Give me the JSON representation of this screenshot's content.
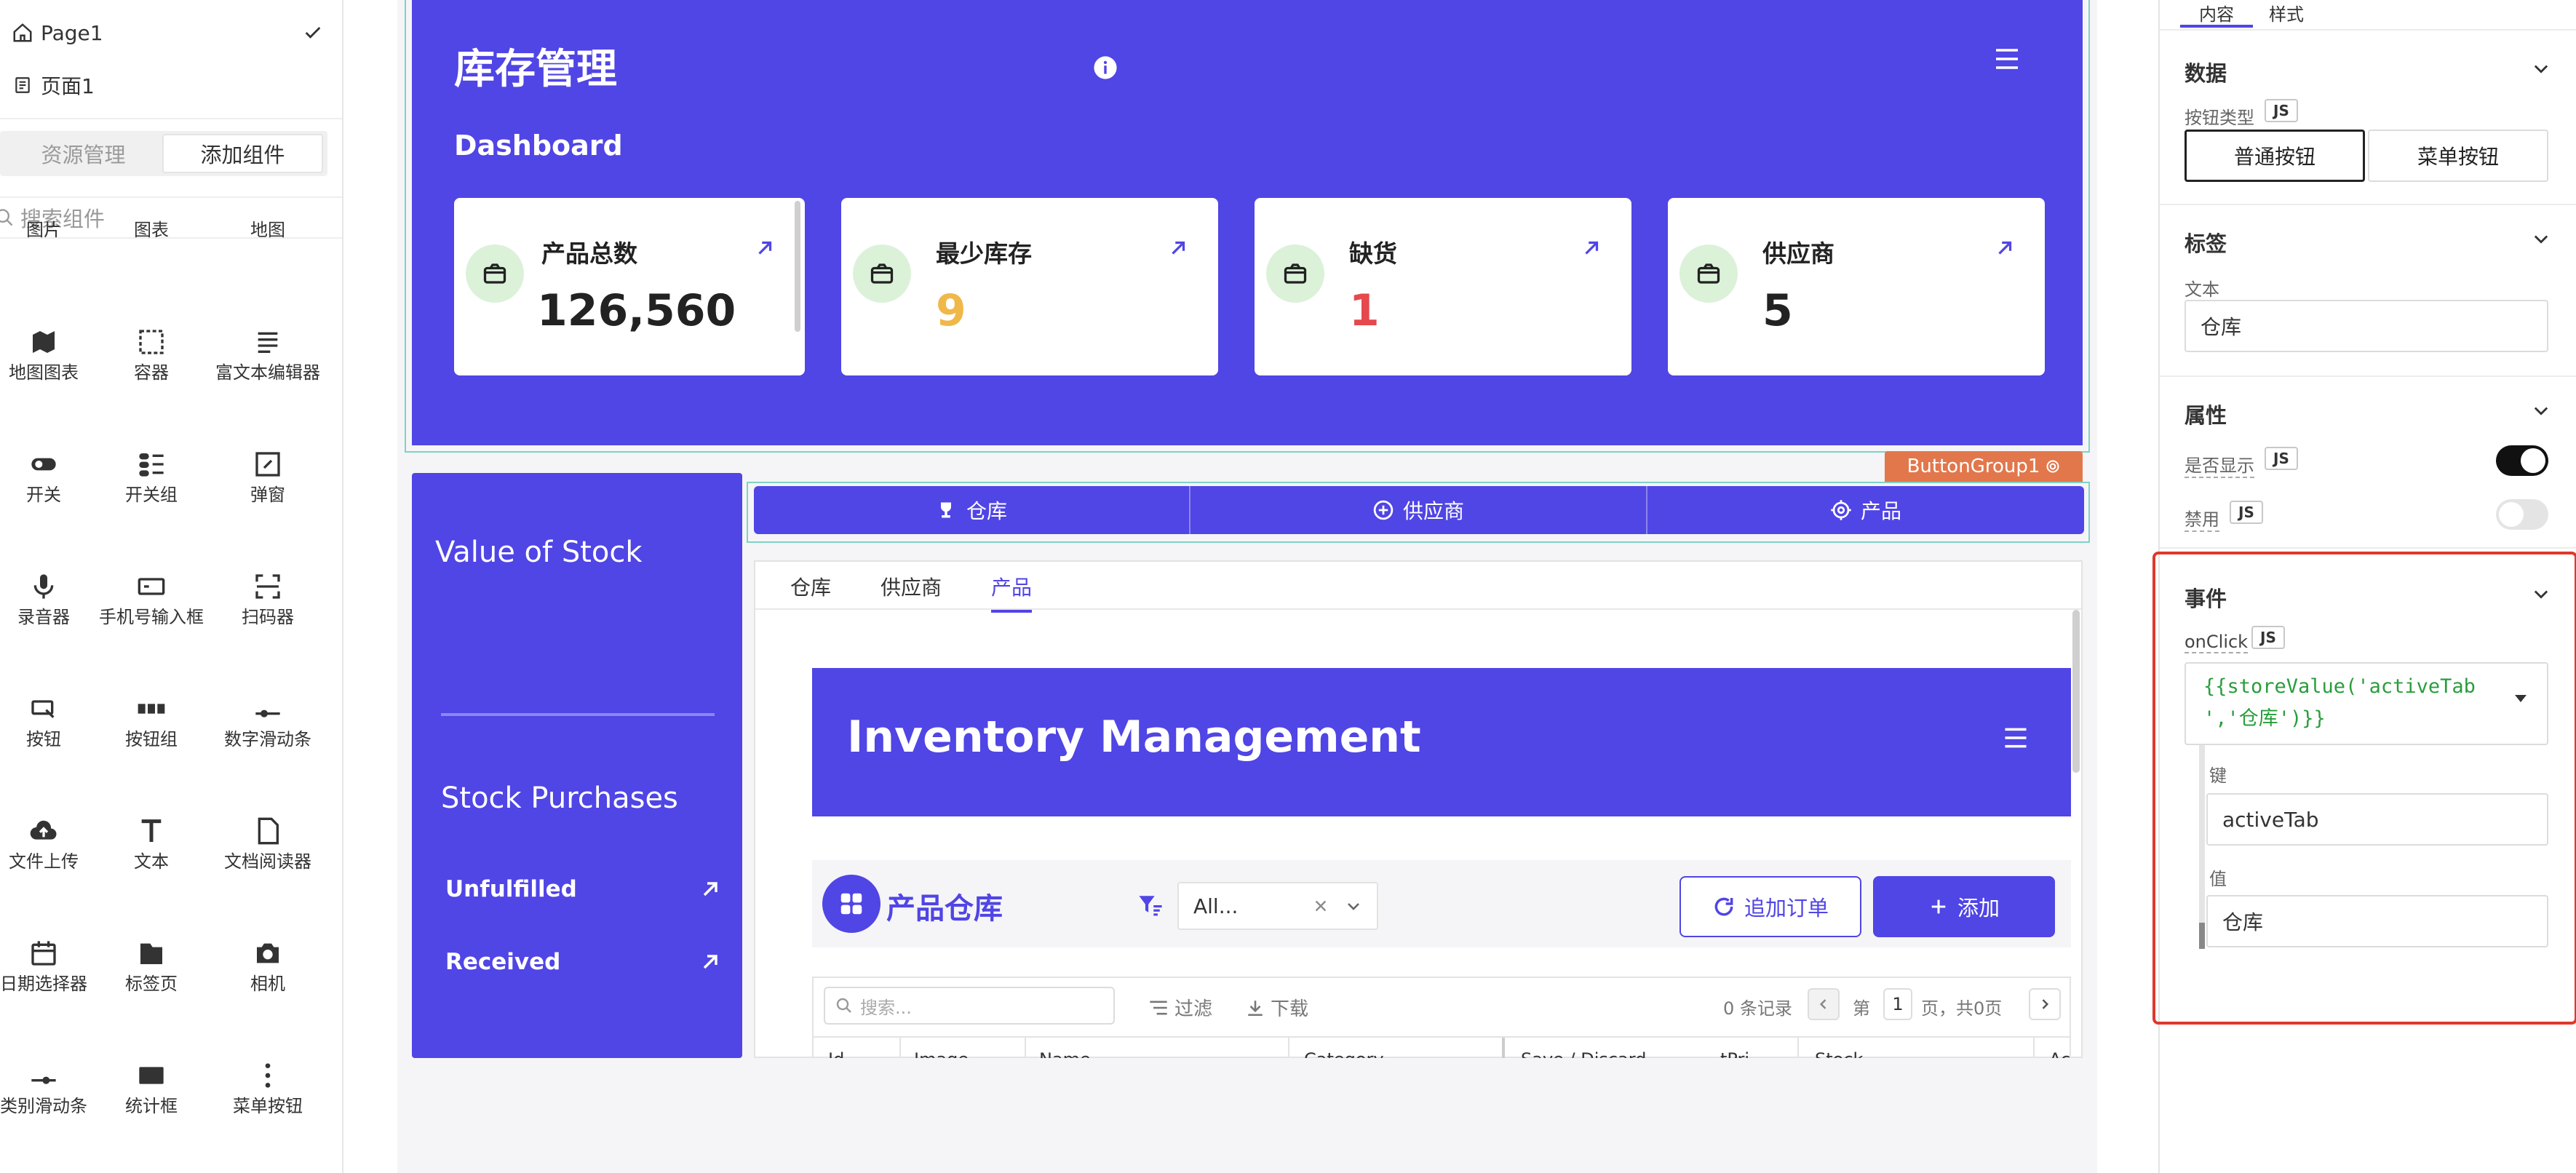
{
  "left": {
    "page_group": "Page1",
    "page_item": "页面1",
    "tabs": [
      "资源管理",
      "添加组件"
    ],
    "search_placeholder": "搜索组件",
    "widgets": [
      {
        "label": "图片",
        "icon": "image-icon"
      },
      {
        "label": "图表",
        "icon": "chart-icon"
      },
      {
        "label": "地图",
        "icon": "map-icon"
      },
      {
        "label": "地图图表",
        "icon": "map-chart-icon"
      },
      {
        "label": "容器",
        "icon": "container-icon"
      },
      {
        "label": "富文本编辑器",
        "icon": "rich-text-icon"
      },
      {
        "label": "开关",
        "icon": "toggle-icon"
      },
      {
        "label": "开关组",
        "icon": "toggle-group-icon"
      },
      {
        "label": "弹窗",
        "icon": "modal-icon"
      },
      {
        "label": "录音器",
        "icon": "microphone-icon"
      },
      {
        "label": "手机号输入框",
        "icon": "phone-input-icon"
      },
      {
        "label": "扫码器",
        "icon": "scanner-icon"
      },
      {
        "label": "按钮",
        "icon": "button-icon"
      },
      {
        "label": "按钮组",
        "icon": "button-group-icon"
      },
      {
        "label": "数字滑动条",
        "icon": "number-slider-icon"
      },
      {
        "label": "文件上传",
        "icon": "upload-icon"
      },
      {
        "label": "文本",
        "icon": "text-icon"
      },
      {
        "label": "文档阅读器",
        "icon": "pdf-icon"
      },
      {
        "label": "日期选择器",
        "icon": "calendar-icon"
      },
      {
        "label": "标签页",
        "icon": "tabs-icon"
      },
      {
        "label": "相机",
        "icon": "camera-icon"
      },
      {
        "label": "类别滑动条",
        "icon": "category-slider-icon"
      },
      {
        "label": "统计框",
        "icon": "stat-box-icon"
      },
      {
        "label": "菜单按钮",
        "icon": "menu-button-icon"
      }
    ]
  },
  "header": {
    "title": "库存管理",
    "subtitle": "Dashboard",
    "cards": [
      {
        "title": "产品总数",
        "value": "126,560",
        "color": "#222222"
      },
      {
        "title": "最少库存",
        "value": "9",
        "color": "#f0b849"
      },
      {
        "title": "缺货",
        "value": "1",
        "color": "#e5484d"
      },
      {
        "title": "供应商",
        "value": "5",
        "color": "#222222"
      }
    ],
    "accent": "#5045e5"
  },
  "sidebar": {
    "value_of_stock": "Value of Stock",
    "stock_purchases": "Stock Purchases",
    "unfulfilled": "Unfulfilled",
    "received": "Received"
  },
  "button_group": {
    "badge": "ButtonGroup1",
    "buttons": [
      "仓库",
      "供应商",
      "产品"
    ]
  },
  "tabs": {
    "items": [
      "仓库",
      "供应商",
      "产品"
    ],
    "active": "产品"
  },
  "inner": {
    "title": "Inventory Management",
    "warehouse_title": "产品仓库",
    "filter_value": "All...",
    "reorder_button": "追加订单",
    "add_button": "添加",
    "table_search_placeholder": "搜索...",
    "filter_label": "过滤",
    "download_label": "下载",
    "record_count": "0 条记录",
    "page_prefix": "第",
    "page_number": "1",
    "page_suffix": "页，共0页",
    "columns": [
      "Id",
      "Image",
      "Name",
      "Category",
      "Save / Discard",
      "tPri",
      "Stock",
      "Ac"
    ]
  },
  "right": {
    "tabs": [
      "内容",
      "样式"
    ],
    "active_tab": "内容",
    "data_section": "数据",
    "button_type_label": "按钮类型",
    "js": "JS",
    "button_types": [
      "普通按钮",
      "菜单按钮"
    ],
    "label_section": "标签",
    "text_label": "文本",
    "text_value": "仓库",
    "props_section": "属性",
    "visible_label": "是否显示",
    "visible_on": true,
    "disabled_label": "禁用",
    "disabled_on": false,
    "events_section": "事件",
    "onclick_label": "onClick",
    "code_line1": "{{storeValue('activeTab",
    "code_line2": "','仓库')}}",
    "key_label": "键",
    "key_value": "activeTab",
    "value_label": "值",
    "value_value": "仓库",
    "highlight_color": "#e0382b"
  }
}
